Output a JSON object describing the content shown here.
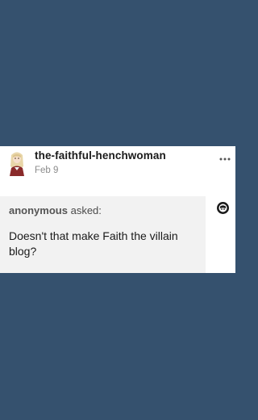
{
  "post": {
    "username": "the-faithful-henchwoman",
    "date": "Feb 9",
    "more_icon": "more-horizontal-icon"
  },
  "ask": {
    "asker": "anonymous",
    "asked_label": "asked:",
    "question": "Doesn't that make Faith the villain blog?",
    "asker_avatar_icon": "anonymous-avatar-icon"
  },
  "colors": {
    "background": "#35516e",
    "card": "#ffffff",
    "ask_bubble": "#f2f2f2"
  }
}
